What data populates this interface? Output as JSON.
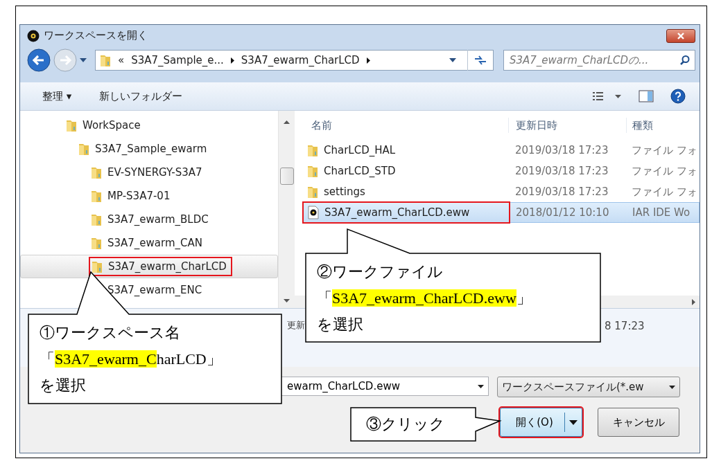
{
  "window": {
    "title": "ワークスペースを開く"
  },
  "address": {
    "crumbs": [
      "«",
      "S3A7_Sample_e...",
      "S3A7_ewarm_CharLCD"
    ]
  },
  "search": {
    "placeholder": "S3A7_ewarm_CharLCDの..."
  },
  "toolbar": {
    "organize": "整理 ▾",
    "new_folder": "新しいフォルダー"
  },
  "tree": [
    {
      "label": "WorkSpace",
      "selected": false,
      "marked": false,
      "children": [
        {
          "label": "S3A7_Sample_ewarm",
          "selected": false,
          "marked": false,
          "children": [
            {
              "label": "EV-SYNERGY-S3A7",
              "selected": false,
              "marked": false
            },
            {
              "label": "MP-S3A7-01",
              "selected": false,
              "marked": false
            },
            {
              "label": "S3A7_ewarm_BLDC",
              "selected": false,
              "marked": false
            },
            {
              "label": "S3A7_ewarm_CAN",
              "selected": false,
              "marked": false
            },
            {
              "label": "S3A7_ewarm_CharLCD",
              "selected": true,
              "marked": true
            },
            {
              "label": "S3A7_ewarm_ENC",
              "selected": false,
              "marked": false
            }
          ]
        }
      ]
    }
  ],
  "table": {
    "columns": [
      "名前",
      "更新日時",
      "種類"
    ],
    "rows": [
      {
        "kind": "folder",
        "name": "CharLCD_HAL",
        "date": "2019/03/18 17:23",
        "type": "ファイル フォ",
        "selected": false,
        "marked": false
      },
      {
        "kind": "folder",
        "name": "CharLCD_STD",
        "date": "2019/03/18 17:23",
        "type": "ファイル フォ",
        "selected": false,
        "marked": false
      },
      {
        "kind": "folder",
        "name": "settings",
        "date": "2019/03/18 17:23",
        "type": "ファイル フォ",
        "selected": false,
        "marked": false
      },
      {
        "kind": "file",
        "name": "S3A7_ewarm_CharLCD.eww",
        "date": "2018/01/12 10:10",
        "type": "IAR IDE Wo",
        "selected": true,
        "marked": true
      }
    ]
  },
  "details": {
    "label": "更新",
    "value": "8 17:23"
  },
  "filename": {
    "value": "ewarm_CharLCD.eww"
  },
  "filetype": {
    "value": "ワークスペースファイル(*.ew"
  },
  "buttons": [
    {
      "label": "開く(O)",
      "kind": "split",
      "marked": true
    },
    {
      "label": "キャンセル",
      "kind": "plain",
      "marked": false
    }
  ],
  "callouts": [
    {
      "kind": "up",
      "lines": [
        [
          {
            "text": "①ワークスペース名",
            "highlight": false
          }
        ],
        [
          {
            "text": "「",
            "highlight": false
          },
          {
            "text": "S3A7_ewarm_C",
            "highlight": true
          },
          {
            "text": "harLCD」",
            "highlight": false
          }
        ],
        [
          {
            "text": "を選択",
            "highlight": false
          }
        ]
      ]
    },
    {
      "kind": "up",
      "lines": [
        [
          {
            "text": "②ワークファイル",
            "highlight": false
          }
        ],
        [
          {
            "text": "「",
            "highlight": false
          },
          {
            "text": "S3A7_ewarm_CharLCD.eww",
            "highlight": true
          },
          {
            "text": "」",
            "highlight": false
          }
        ],
        [
          {
            "text": "を選択",
            "highlight": false
          }
        ]
      ]
    },
    {
      "kind": "right",
      "lines": [
        [
          {
            "text": "③クリック",
            "highlight": false
          }
        ]
      ]
    }
  ]
}
